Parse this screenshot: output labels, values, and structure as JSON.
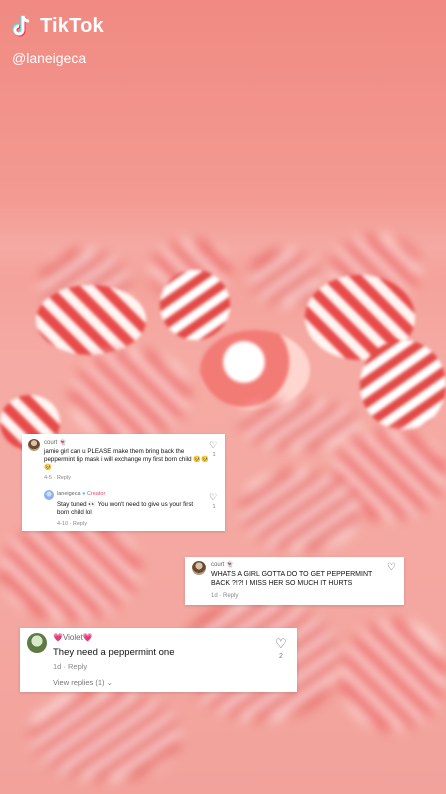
{
  "brand": {
    "name": "TikTok",
    "handle": "@laneigeca"
  },
  "comments": [
    {
      "user": "court 👻",
      "text": "jamie girl can u PLEASE make them bring back the peppermint lip mask i will exchange my first born child 🥺🥺🥺",
      "meta": "4-5 · Reply",
      "likes": "1",
      "reply": {
        "user": "laneigeca",
        "badge": "Creator",
        "text": "Stay tuned 👀 You won't need to give us your first born child lol",
        "meta": "4-10 · Reply",
        "likes": "1"
      }
    },
    {
      "user": "court 👻",
      "text": "WHATS A GIRL GOTTA DO TO GET PEPPERMINT BACK ?!?! I MISS HER SO MUCH IT HURTS",
      "meta": "1d · Reply",
      "likes": ""
    },
    {
      "user": "💗Violet💗",
      "text": "They need a peppermint one",
      "meta": "1d · Reply",
      "likes": "2",
      "view_replies": "View replies (1) ⌄"
    }
  ]
}
